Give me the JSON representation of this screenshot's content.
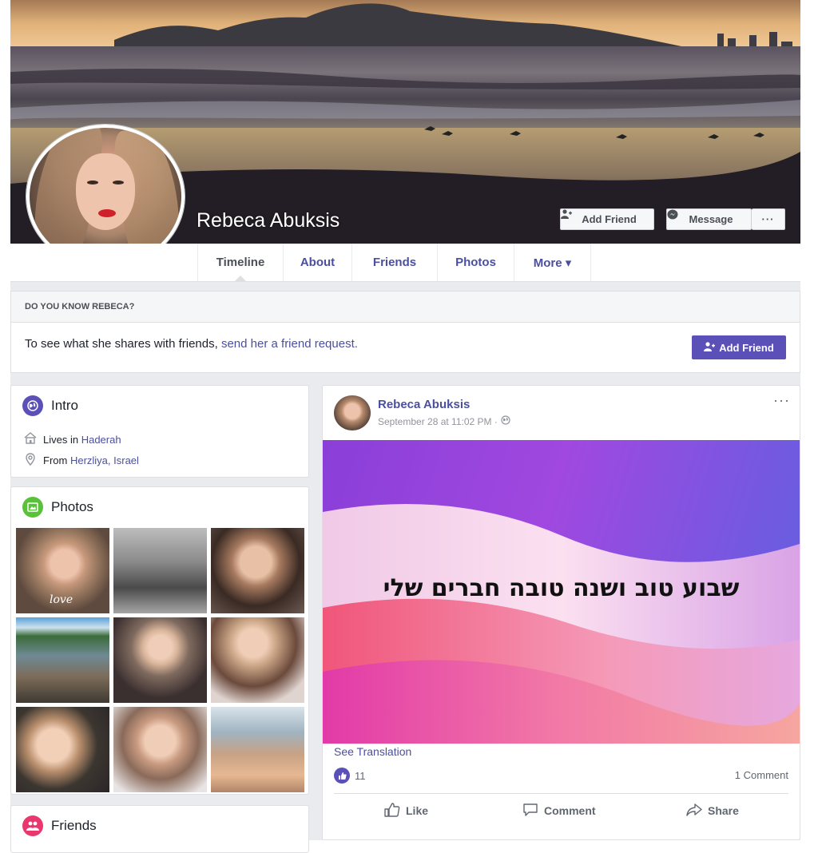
{
  "profile": {
    "name": "Rebeca Abuksis",
    "add_friend_label": "Add Friend",
    "message_label": "Message",
    "more_dots": "···"
  },
  "nav": {
    "tabs": [
      {
        "label": "Timeline"
      },
      {
        "label": "About"
      },
      {
        "label": "Friends"
      },
      {
        "label": "Photos"
      },
      {
        "label": "More ▾"
      }
    ]
  },
  "know": {
    "header": "DO YOU KNOW REBECA?",
    "text": "To see what she shares with friends, ",
    "link": "send her a friend request.",
    "button": "Add Friend"
  },
  "intro": {
    "title": "Intro",
    "lives_prefix": "Lives in ",
    "lives_link": "Haderah",
    "from_prefix": "From ",
    "from_link": "Herzliya, Israel"
  },
  "photos": {
    "title": "Photos",
    "first_caption": "love"
  },
  "friends": {
    "title": "Friends"
  },
  "post": {
    "author": "Rebeca Abuksis",
    "date": "September 28 at 11:02 PM · ",
    "more": "···",
    "text": "שבוע טוב ושנה טובה חברים שלי",
    "see_translation": "See Translation",
    "like_count": "11",
    "comment_count": "1 Comment",
    "like_label": "Like",
    "comment_label": "Comment",
    "share_label": "Share"
  },
  "colors": {
    "accent": "#5b50b8",
    "link": "#4b4f9e",
    "background": "#e9ebee"
  }
}
